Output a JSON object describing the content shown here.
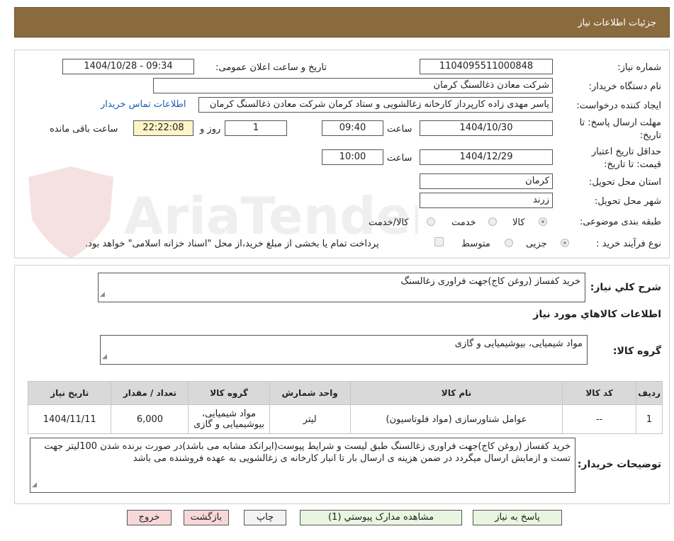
{
  "header": {
    "title": "جزئیات اطلاعات نیاز"
  },
  "watermark": {
    "text": "AriaTender.neT"
  },
  "form": {
    "need_number": {
      "label": "شماره نیاز:",
      "value": "1104095511000848"
    },
    "announce": {
      "label": "تاریخ و ساعت اعلان عمومی:",
      "value": "1404/10/28 - 09:34"
    },
    "buyer_org": {
      "label": "نام دستگاه خریدار:",
      "value": "شرکت معادن ذغالسنگ کرمان"
    },
    "requester": {
      "label": "ایجاد کننده درخواست:",
      "value": "یاسر مهدی زاده کارپرداز کارخانه زغالشویی و ستاد کرمان شرکت معادن ذغالسنگ کرمان"
    },
    "contact_link": "اطلاعات تماس خریدار",
    "deadline": {
      "label_line1": "مهلت ارسال پاسخ: تا",
      "label_line2": "تاریخ:",
      "date": "1404/10/30",
      "time_label": "ساعت",
      "time": "09:40",
      "days": "1",
      "days_label": "روز و",
      "remaining": "22:22:08",
      "remaining_label": "ساعت باقی مانده"
    },
    "validity": {
      "label_line1": "حداقل تاریخ اعتبار",
      "label_line2": "قیمت: تا تاریخ:",
      "date": "1404/12/29",
      "time_label": "ساعت",
      "time": "10:00"
    },
    "province": {
      "label": "استان محل تحویل:",
      "value": "کرمان"
    },
    "city": {
      "label": "شهر محل تحویل:",
      "value": "زرند"
    },
    "category": {
      "label": "طبقه بندی موضوعی:",
      "options": [
        "کالا",
        "خدمت",
        "کالا/خدمت"
      ],
      "selected": "کالا"
    },
    "process": {
      "label": "نوع فرآیند خرید :",
      "options": [
        "جزیی",
        "متوسط"
      ],
      "selected": "جزیی",
      "payment_note": "پرداخت تمام یا بخشی از مبلغ خرید،از محل \"اسناد خزانه اسلامی\" خواهد بود."
    }
  },
  "summary": {
    "label": "شرح کلي نياز:",
    "value": "خرید کفساز (روغن کاج)جهت فراوری زغالسنگ"
  },
  "goods_info": {
    "title": "اطلاعات کالاهاي مورد نياز",
    "group_label": "گروه کالا:",
    "group_value": "مواد شیمیایی، بیوشیمیایی و  گازی",
    "columns": [
      "رديف",
      "کد کالا",
      "نام کالا",
      "واحد شمارش",
      "گروه کالا",
      "تعداد / مقدار",
      "تاريخ نياز"
    ],
    "rows": [
      [
        "1",
        "--",
        "عوامل شناورسازی (مواد فلوتاسیون)",
        "لیتر",
        "مواد شیمیایی، بیوشیمیایی و گازی",
        "6,000",
        "1404/11/11"
      ]
    ]
  },
  "buyer_notes": {
    "label": "توضیحات خریدار:",
    "value": "خرید کفساز (روغن کاج)جهت فراوری زغالسنگ طبق لیست و شرایط پیوست(ایرانکد مشابه می باشد)در صورت برنده شدن 100لیتر جهت تست و ازمایش ارسال میگردد در ضمن هزینه ی ارسال بار تا انبار کارخانه ی زغالشویی به عهده فروشنده می باشد"
  },
  "buttons": {
    "reply": "پاسخ به نیاز",
    "attachments": "مشاهده مدارک پیوستي (1)",
    "print": "چاپ",
    "back": "بازگشت",
    "exit": "خروج"
  }
}
